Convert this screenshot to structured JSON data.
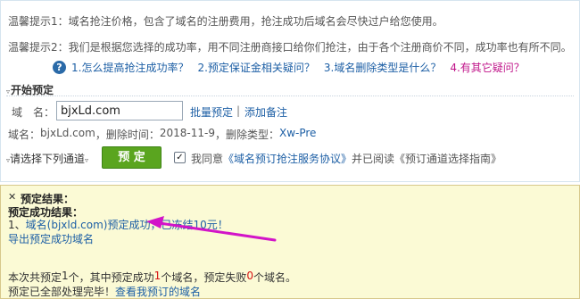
{
  "tips": {
    "tip1": "温馨提示1：域名抢注价格，包含了域名的注册费用，抢注成功后域名会尽快过户给您使用。",
    "tip2": "温馨提示2：我们是根据您选择的成功率，用不同注册商接口给你们抢注，由于各个注册商价不同，成功率也有所不同。"
  },
  "faq": {
    "icon": "question-icon",
    "items": [
      "1.怎么提高抢注成功率？",
      "2.预定保证金相关疑问？",
      "3.域名删除类型是什么？",
      "4.有其它疑问？"
    ]
  },
  "start_section": {
    "title": "开始预定"
  },
  "domain_form": {
    "label": "域　名：",
    "value": "bjxLd.com",
    "batch_link": "批量预定",
    "separator": "|",
    "note_link": "添加备注"
  },
  "domain_info": {
    "prefix": "域名：",
    "domain": "bjxLd.com",
    "delete_time_label": "，删除时间：",
    "delete_time": "2018-11-9",
    "delete_type_label": "，删除类型：",
    "delete_type": "Xw-Pre"
  },
  "channel": {
    "label": "请选择下列通道",
    "button": "预 定",
    "checkbox_checked": true,
    "agree_prefix": "我同意",
    "agreement_link": "《域名预订抢注服务协议》",
    "agree_middle": "并已阅读",
    "guide": "《预订通道选择指南》"
  },
  "result": {
    "close_icon": "close-icon",
    "title": "预定结果：",
    "success_title": "预定成功结果：",
    "line1_prefix": "1、",
    "line1_link": "域名(bjxld.com)预定成功，已冻结10元！",
    "export_link": "导出预定成功域名",
    "summary_prefix": "本次共预定",
    "summary_total": "1",
    "summary_mid1": "个，其中预定成功",
    "summary_success": "1",
    "summary_mid2": "个域名，预定失败",
    "summary_fail": "0",
    "summary_suffix": "个域名。",
    "done_text": "预定已全部处理完毕！",
    "view_link": "查看我预订的域名"
  },
  "colors": {
    "link": "#1d5fa5",
    "highlight_link": "#c0148a",
    "button_green": "#5aa51f",
    "result_bg": "#fbfad5",
    "arrow": "#d214c8",
    "count_red": "#d61616"
  }
}
